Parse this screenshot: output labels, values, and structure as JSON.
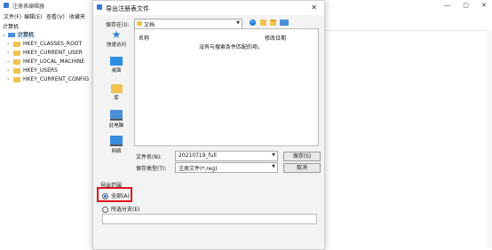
{
  "app": {
    "title": "注册表编辑器",
    "menu": [
      "文件(F)",
      "编辑(E)",
      "查看(V)",
      "收藏夹"
    ],
    "address": "计算机",
    "window_controls": [
      "—",
      "▢",
      "✕"
    ]
  },
  "tree": {
    "root": "计算机",
    "items": [
      "HKEY_CLASSES_ROOT",
      "HKEY_CURRENT_USER",
      "HKEY_LOCAL_MACHINE",
      "HKEY_USERS",
      "HKEY_CURRENT_CONFIG"
    ]
  },
  "dialog": {
    "title": "导出注册表文件",
    "close": "✕",
    "save_in_label": "保存在(I):",
    "save_in_value": "文档",
    "toolbar_icons": [
      "back-icon",
      "up-folder-icon",
      "new-folder-icon",
      "view-menu-icon"
    ],
    "places": [
      "快速访问",
      "桌面",
      "库",
      "此电脑",
      "网络"
    ],
    "columns": [
      "名称",
      "修改日期"
    ],
    "empty_message": "没有与搜索条件匹配的项。",
    "filename_label": "文件名(N):",
    "filename_value": "20210719_full",
    "filetype_label": "保存类型(T):",
    "filetype_value": "注册文件(*.reg)",
    "save_button": "保存(S)",
    "cancel_button": "取消",
    "export_range_label": "导出范围",
    "option_all": "全部(A)",
    "option_branch": "所选分支(E)",
    "branch_value": "",
    "selected_option": "all",
    "accent_color": "#1a5fd0",
    "highlight_color": "#e0121a"
  }
}
